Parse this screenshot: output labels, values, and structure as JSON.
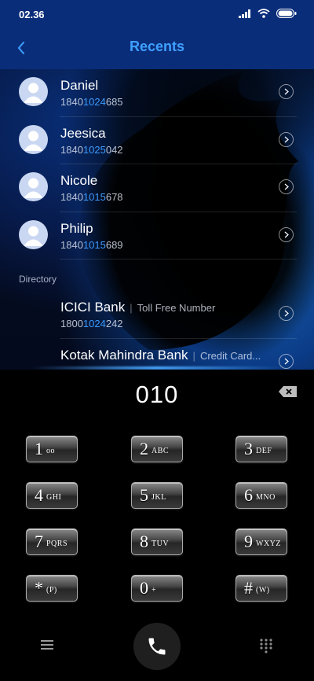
{
  "status_bar": {
    "time": "02.36"
  },
  "header": {
    "title": "Recents"
  },
  "recents": [
    {
      "name": "Daniel",
      "number_pre": "1840",
      "number_match": "1024",
      "number_post": "685"
    },
    {
      "name": "Jeesica",
      "number_pre": "1840",
      "number_match": "1025",
      "number_post": "042"
    },
    {
      "name": "Nicole",
      "number_pre": "1840",
      "number_match": "1015",
      "number_post": "678"
    },
    {
      "name": "Philip",
      "number_pre": "1840",
      "number_match": "1015",
      "number_post": "689"
    }
  ],
  "directory": {
    "label": "Directory",
    "items": [
      {
        "name": "ICICI Bank",
        "subtitle": "Toll Free Number",
        "number_pre": "1800",
        "number_match": "1024",
        "number_post": "242"
      },
      {
        "name": "Kotak Mahindra Bank",
        "subtitle": "Credit Card..."
      }
    ]
  },
  "dialer": {
    "input": "010",
    "keys": [
      {
        "digit": "1",
        "letters": "oo"
      },
      {
        "digit": "2",
        "letters": "ABC"
      },
      {
        "digit": "3",
        "letters": "DEF"
      },
      {
        "digit": "4",
        "letters": "GHI"
      },
      {
        "digit": "5",
        "letters": "JKL"
      },
      {
        "digit": "6",
        "letters": "MNO"
      },
      {
        "digit": "7",
        "letters": "PQRS"
      },
      {
        "digit": "8",
        "letters": "TUV"
      },
      {
        "digit": "9",
        "letters": "WXYZ"
      },
      {
        "digit": "*",
        "letters": "(P)"
      },
      {
        "digit": "0",
        "letters": "+"
      },
      {
        "digit": "#",
        "letters": "(W)"
      }
    ]
  },
  "colors": {
    "header_bg": "#0a2d7a",
    "accent": "#3ea0ff",
    "match_highlight": "#3b9bff"
  },
  "icons": {
    "back": "chevron-left-icon",
    "signal": "signal-icon",
    "wifi": "wifi-icon",
    "battery": "battery-icon",
    "backspace": "backspace-icon",
    "menu": "menu-icon",
    "call": "phone-icon",
    "keypad_toggle": "dialpad-icon",
    "contact": "contact-avatar-icon",
    "detail": "chevron-right-circle-icon"
  }
}
